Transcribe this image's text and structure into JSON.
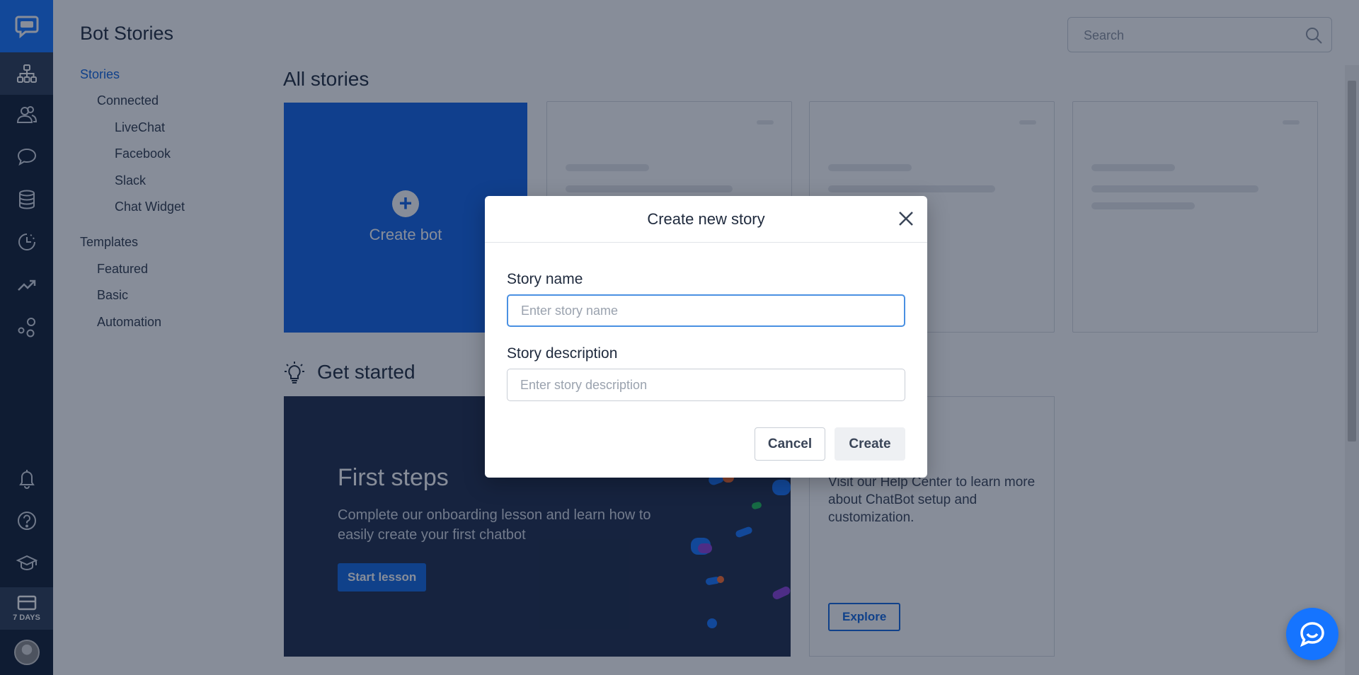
{
  "app": {
    "title": "Bot Stories",
    "trial_label": "7 DAYS"
  },
  "colors": {
    "rail": "#0f1c33",
    "accent": "#1574ff",
    "primary": "#1163e6",
    "dark_card": "#1c2a4a"
  },
  "rail": {
    "icons": [
      "chatbot-logo-icon",
      "stories-icon",
      "users-icon",
      "chats-icon",
      "database-icon",
      "history-icon",
      "analytics-icon",
      "integrations-icon",
      "bell-icon",
      "help-icon",
      "academy-icon",
      "billing-icon"
    ]
  },
  "nav": {
    "stories": "Stories",
    "connected": "Connected",
    "livechat": "LiveChat",
    "facebook": "Facebook",
    "slack": "Slack",
    "chat_widget": "Chat Widget",
    "templates": "Templates",
    "featured": "Featured",
    "basic": "Basic",
    "automation": "Automation"
  },
  "search": {
    "placeholder": "Search"
  },
  "main": {
    "all_stories_title": "All stories",
    "create_bot_label": "Create bot",
    "get_started_title": "Get started",
    "first_steps": {
      "title": "First steps",
      "description": "Complete our onboarding lesson and learn how to easily create your first chatbot",
      "button": "Start lesson"
    },
    "help_center": {
      "description": "Visit our Help Center to learn more about ChatBot setup and customization.",
      "button": "Explore"
    }
  },
  "modal": {
    "title": "Create new story",
    "name_label": "Story name",
    "name_placeholder": "Enter story name",
    "name_value": "",
    "description_label": "Story description",
    "description_placeholder": "Enter story description",
    "description_value": "",
    "cancel": "Cancel",
    "create": "Create"
  }
}
